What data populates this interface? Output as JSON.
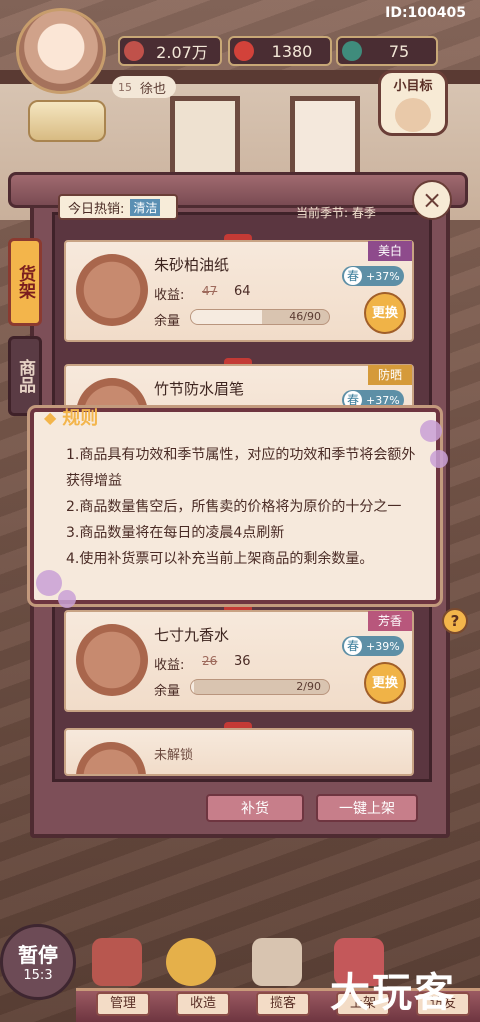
{
  "id_label": "ID:100405",
  "player": {
    "name": "徐也",
    "level": "15"
  },
  "resources": [
    {
      "icon": "copper-coin-icon",
      "value": "2.07万"
    },
    {
      "icon": "red-gem-icon",
      "value": "1380"
    },
    {
      "icon": "green-orb-icon",
      "value": "75"
    }
  ],
  "goal_button": "小目标",
  "shop": {
    "hot_sale_label": "今日热销:",
    "hot_sale_tag": "清洁",
    "current_season": "当前季节: 春季",
    "side_tabs": [
      "货架",
      "商品"
    ]
  },
  "items": [
    {
      "name": "朱砂柏油纸",
      "income_label": "收益:",
      "old_price": "47",
      "new_price": "64",
      "stock_label": "余量",
      "stock_text": "46/90",
      "stock_fraction": 0.511,
      "effect": "美白",
      "season": "春",
      "bonus": "+37%",
      "swap": "更换"
    },
    {
      "name": "竹节防水眉笔",
      "effect": "防晒",
      "season": "春",
      "bonus": "+37%"
    },
    {
      "name": "七寸九香水",
      "income_label": "收益:",
      "old_price": "26",
      "new_price": "36",
      "stock_label": "余量",
      "stock_text": "2/90",
      "stock_fraction": 0.022,
      "effect": "芳香",
      "season": "春",
      "bonus": "+39%",
      "swap": "更换"
    },
    {
      "locked_label": "未解锁"
    }
  ],
  "rules": {
    "title": "规则",
    "lines": [
      "1.商品具有功效和季节属性，对应的功效和季节将会额外获得增益",
      "2.商品数量售空后，所售卖的价格将为原价的十分之一",
      "3.商品数量将在每日的凌晨4点刷新",
      "4.使用补货票可以补充当前上架商品的剩余数量。"
    ]
  },
  "actions": {
    "restock": "补货",
    "one_click": "一键上架",
    "help": "?"
  },
  "pause": {
    "label": "暂停",
    "clock": "15:3"
  },
  "nav": [
    "管理",
    "收造",
    "揽客",
    "上架",
    "访友"
  ],
  "watermark": "大玩客"
}
